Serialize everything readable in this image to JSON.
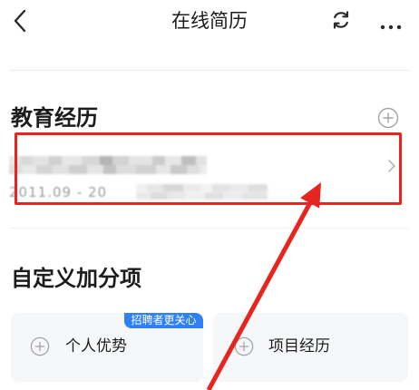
{
  "header": {
    "title": "在线简历",
    "back_icon": "chevron-left-icon",
    "refresh_icon": "refresh-icon",
    "more_icon": "more-icon"
  },
  "education": {
    "title": "教育经历",
    "add_icon": "plus-circle-icon",
    "entry": {
      "date_text": "2011.09 - 20",
      "chevron_icon": "chevron-right-icon"
    }
  },
  "custom": {
    "title": "自定义加分项",
    "cards": [
      {
        "label": "个人优势",
        "badge": "招聘者更关心",
        "icon": "plus-circle-icon"
      },
      {
        "label": "项目经历",
        "icon": "plus-circle-icon"
      }
    ]
  },
  "colors": {
    "text": "#1c1c1c",
    "muted": "#9c9c9c",
    "divider": "#ededed",
    "card_background": "#f6f7f9",
    "badge": "#2f80f5",
    "annotation": "#e8241e"
  }
}
